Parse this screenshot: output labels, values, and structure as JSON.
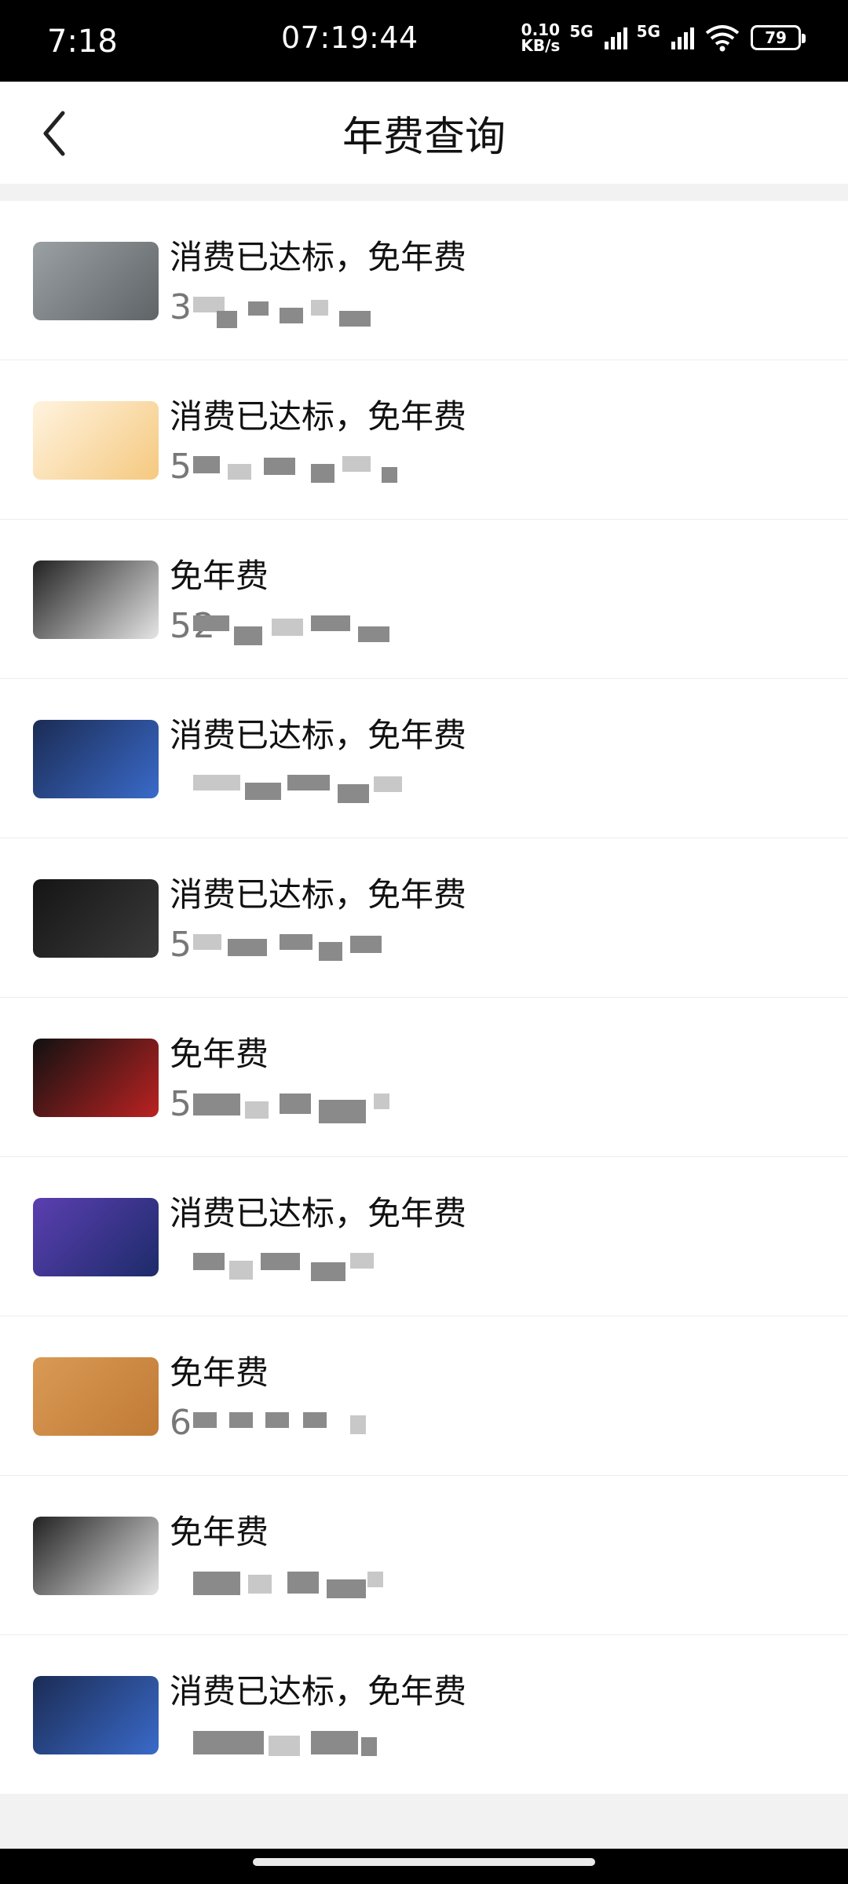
{
  "status_bar": {
    "time": "7:18",
    "center_time": "07:19:44",
    "net_speed_top": "0.10",
    "net_speed_bottom": "KB/s",
    "gen1": "5G",
    "gen2": "5G",
    "battery": "79"
  },
  "header": {
    "title": "年费查询"
  },
  "cards": [
    {
      "status": "消费已达标，免年费",
      "number": "3",
      "card_colors": [
        "#9aa0a3",
        "#5f6467"
      ]
    },
    {
      "status": "消费已达标，免年费",
      "number": "5",
      "card_colors": [
        "#fff3df",
        "#f5c97f"
      ]
    },
    {
      "status": "免年费",
      "number": "52",
      "card_colors": [
        "#222",
        "#e5e5e5"
      ]
    },
    {
      "status": "消费已达标，免年费",
      "number": "",
      "card_colors": [
        "#1b2c55",
        "#3a6ac9"
      ]
    },
    {
      "status": "消费已达标，免年费",
      "number": "5",
      "card_colors": [
        "#151515",
        "#3a3a3a"
      ]
    },
    {
      "status": "免年费",
      "number": "5",
      "card_colors": [
        "#111",
        "#b22"
      ]
    },
    {
      "status": "消费已达标，免年费",
      "number": "",
      "card_colors": [
        "#5b3fb0",
        "#1d2b6a"
      ]
    },
    {
      "status": "免年费",
      "number": "6",
      "card_colors": [
        "#d99a55",
        "#c07a36"
      ]
    },
    {
      "status": "免年费",
      "number": "",
      "card_colors": [
        "#222",
        "#e5e5e5"
      ]
    },
    {
      "status": "消费已达标，免年费",
      "number": "",
      "card_colors": [
        "#1b2c55",
        "#3a6ac9"
      ]
    }
  ]
}
